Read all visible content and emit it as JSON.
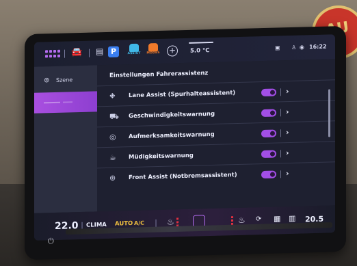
{
  "background": {
    "sign_text": "AU"
  },
  "topbar": {
    "parking_label": "P",
    "assist_label": "ASSIST",
    "modes_label": "MODES",
    "add_symbol": "+",
    "outside_temp": "5.0 °C",
    "clock": "16:22"
  },
  "sidebar": {
    "items": [
      {
        "label": "Szene",
        "icon": "scene-icon"
      },
      {
        "label": "",
        "icon": "active-item"
      }
    ]
  },
  "main": {
    "title": "Einstellungen Fahrerassistenz",
    "rows": [
      {
        "icon": "lane-assist-icon",
        "label": "Lane Assist (Spurhalteassistent)",
        "toggle_on": true
      },
      {
        "icon": "speed-warning-icon",
        "label": "Geschwindigkeitswarnung",
        "toggle_on": true
      },
      {
        "icon": "attention-icon",
        "label": "Aufmerksamkeitswarnung",
        "toggle_on": true
      },
      {
        "icon": "fatigue-icon",
        "label": "Müdigkeitswarnung",
        "toggle_on": true
      },
      {
        "icon": "front-assist-icon",
        "label": "Front Assist (Notbremsassistent)",
        "toggle_on": true
      }
    ]
  },
  "bottombar": {
    "left_temp": "22.0",
    "clima_label": "CLIMA",
    "auto_label": "AUTO",
    "ac_label": "A/C",
    "right_temp": "20.5"
  },
  "colors": {
    "accent": "#a24fe6",
    "auto": "#f0c040",
    "parking": "#3a7ef0"
  }
}
